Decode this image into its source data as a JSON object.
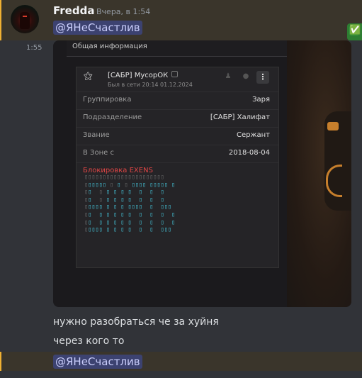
{
  "message": {
    "author": "Fredda",
    "timestamp": "Вчера, в 1:54",
    "mention": "@ЯНеСчастлив",
    "side_time": "1:55",
    "lines": [
      "нужно разобраться че за хуйня",
      "через кого то"
    ],
    "final_mention": "@ЯНеСчастлив",
    "reaction": "✅"
  },
  "screenshot": {
    "header": "Общая информация",
    "profile": {
      "name": "[САБР] МусорОК",
      "status": "Был в сети 20:14 01.12.2024"
    },
    "fields": [
      {
        "key": "Группировка",
        "value": "Заря"
      },
      {
        "key": "Подразделение",
        "value": "[САБР] Халифат"
      },
      {
        "key": "Звание",
        "value": "Сержант"
      },
      {
        "key": "В Зоне с",
        "value": "2018-08-04"
      }
    ],
    "warning": "Блокировка EXENS"
  },
  "colors": {
    "background": "#313338",
    "mention_bg": "#3c4270",
    "highlight": "#3a352b",
    "warning": "#e04646",
    "glyph": "#45c3d8"
  }
}
